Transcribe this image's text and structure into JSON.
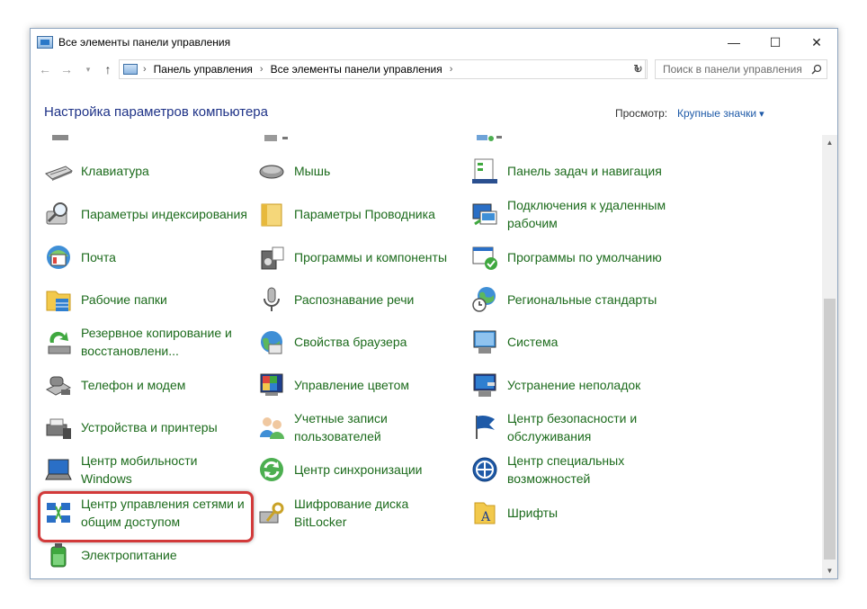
{
  "window": {
    "title": "Все элементы панели управления",
    "controls": {
      "minimize": "—",
      "maximize": "☐",
      "close": "✕"
    }
  },
  "address": {
    "crumbs": [
      "Панель управления",
      "Все элементы панели управления"
    ],
    "search_placeholder": "Поиск в панели управления"
  },
  "header": {
    "title": "Настройка параметров компьютера",
    "view_label": "Просмотр:",
    "view_value": "Крупные значки"
  },
  "items": [
    {
      "label": "Клавиатура",
      "icon": "keyboard-icon"
    },
    {
      "label": "Мышь",
      "icon": "mouse-icon"
    },
    {
      "label": "Панель задач и навигация",
      "icon": "taskbar-icon"
    },
    {
      "label": "Параметры индексирования",
      "icon": "indexing-icon"
    },
    {
      "label": "Параметры Проводника",
      "icon": "folder-options-icon"
    },
    {
      "label": "Подключения к удаленным рабочим",
      "icon": "remote-desktop-icon"
    },
    {
      "label": "Почта",
      "icon": "mail-icon"
    },
    {
      "label": "Программы и компоненты",
      "icon": "programs-icon"
    },
    {
      "label": "Программы по умолчанию",
      "icon": "default-programs-icon"
    },
    {
      "label": "Рабочие папки",
      "icon": "work-folders-icon"
    },
    {
      "label": "Распознавание речи",
      "icon": "microphone-icon"
    },
    {
      "label": "Региональные стандарты",
      "icon": "globe-clock-icon"
    },
    {
      "label": "Резервное копирование и восстановлени...",
      "icon": "backup-icon"
    },
    {
      "label": "Свойства браузера",
      "icon": "browser-icon"
    },
    {
      "label": "Система",
      "icon": "system-icon"
    },
    {
      "label": "Телефон и модем",
      "icon": "phone-icon"
    },
    {
      "label": "Управление цветом",
      "icon": "color-icon"
    },
    {
      "label": "Устранение неполадок",
      "icon": "troubleshoot-icon"
    },
    {
      "label": "Устройства и принтеры",
      "icon": "printer-icon"
    },
    {
      "label": "Учетные записи пользователей",
      "icon": "users-icon"
    },
    {
      "label": "Центр безопасности и обслуживания",
      "icon": "flag-icon"
    },
    {
      "label": "Центр мобильности Windows",
      "icon": "mobility-icon"
    },
    {
      "label": "Центр синхронизации",
      "icon": "sync-icon"
    },
    {
      "label": "Центр специальных возможностей",
      "icon": "accessibility-icon"
    },
    {
      "label": "Центр управления сетями и общим доступом",
      "icon": "network-icon"
    },
    {
      "label": "Шифрование диска BitLocker",
      "icon": "bitlocker-icon"
    },
    {
      "label": "Шрифты",
      "icon": "fonts-icon"
    },
    {
      "label": "Электропитание",
      "icon": "power-icon"
    }
  ],
  "colors": {
    "link_green": "#1c6b1c",
    "title_blue": "#1e3287",
    "highlight_red": "#d23a3a"
  }
}
